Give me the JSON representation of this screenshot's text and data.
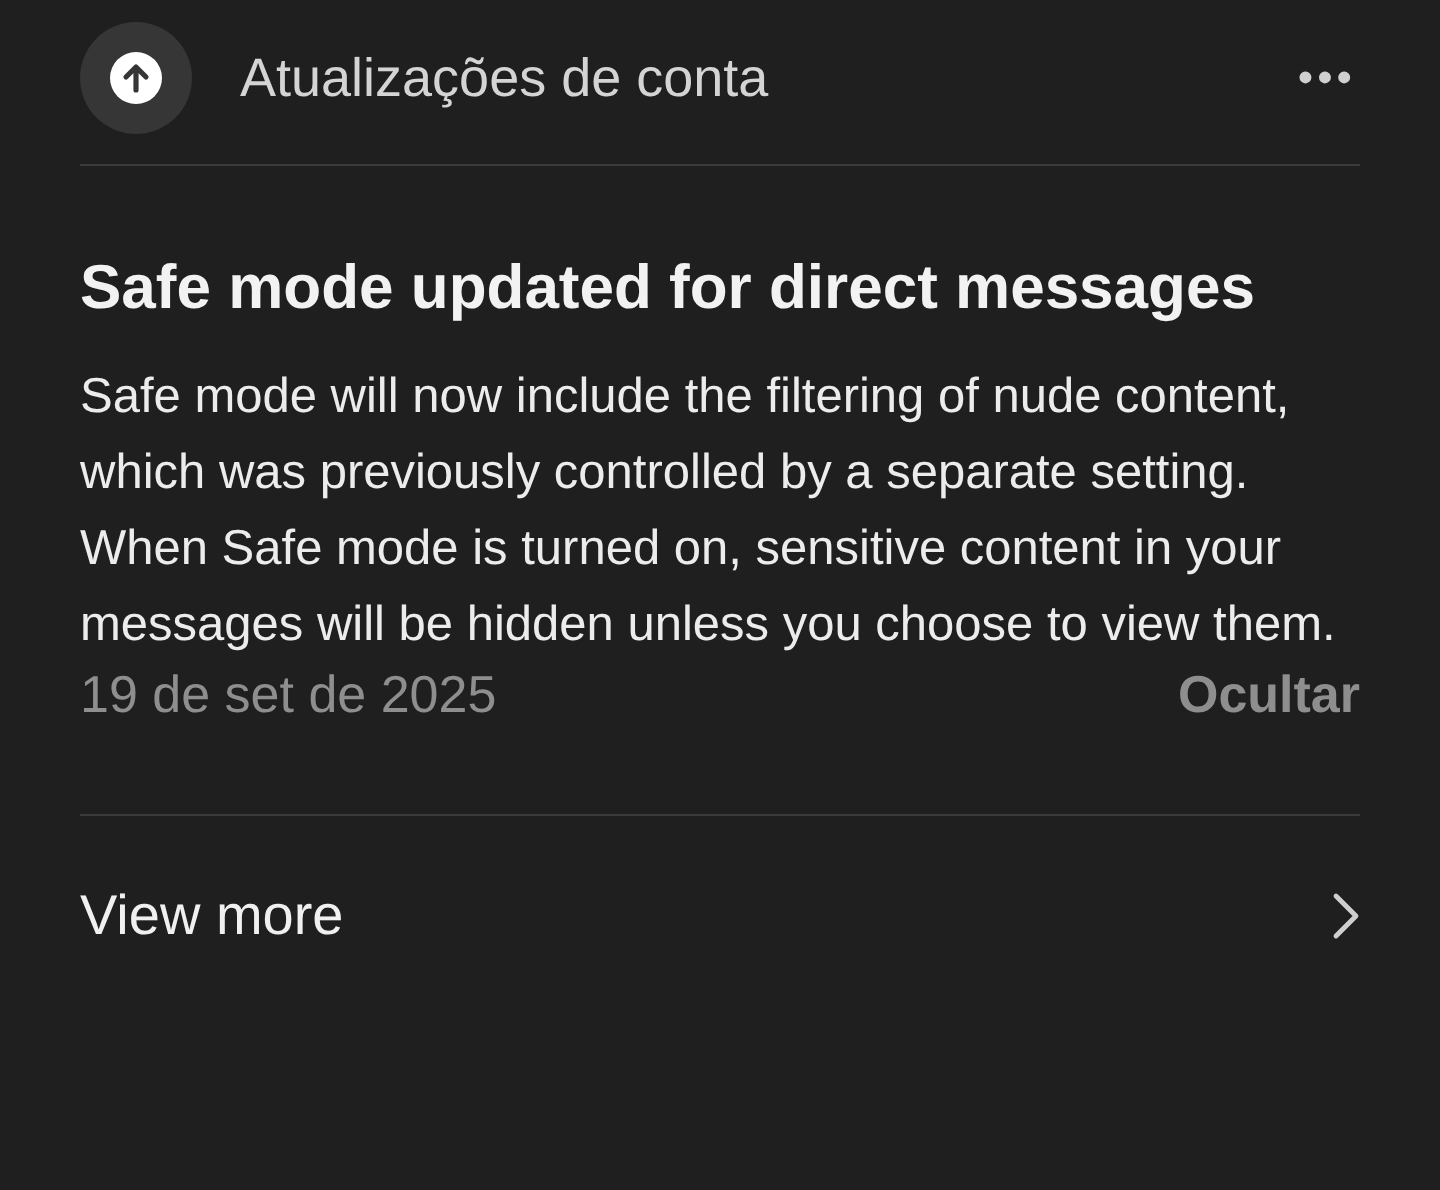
{
  "header": {
    "title": "Atualizações de conta",
    "more": "•••"
  },
  "notice": {
    "title": "Safe mode updated for direct messages",
    "body": "Safe mode will now include the filtering of nude content, which was previously controlled by a separate setting. When Safe mode is turned on, sensitive content in your messages will be hidden unless you choose to view them.",
    "date": "19 de set de 2025",
    "dismiss": "Ocultar"
  },
  "footer": {
    "label": "View more"
  }
}
